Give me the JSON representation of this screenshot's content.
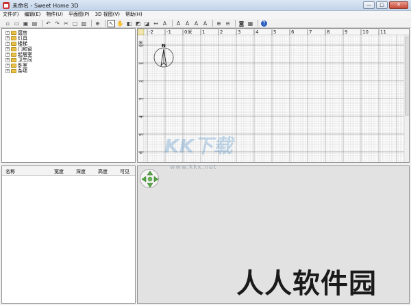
{
  "window": {
    "title": "未命名 - Sweet Home 3D",
    "minimize": "—",
    "maximize": "□",
    "close": "✕"
  },
  "menu": [
    "文件(F)",
    "编辑(E)",
    "物件(U)",
    "平面图(P)",
    "3D 视图(V)",
    "帮助(H)"
  ],
  "toolbar": {
    "help": "?"
  },
  "catalog": {
    "items": [
      "厨房",
      "灯具",
      "楼梯",
      "门和窗",
      "起居室",
      "卫生间",
      "卧室",
      "杂项"
    ]
  },
  "furniture_table": {
    "columns": [
      "名称",
      "宽度",
      "深度",
      "高度",
      "可见"
    ]
  },
  "plan": {
    "ruler_x": [
      "-2",
      "-1",
      "0米",
      "1",
      "2",
      "3",
      "4",
      "5",
      "6",
      "7",
      "8",
      "9",
      "10",
      "11"
    ],
    "ruler_y": [
      "0米",
      "1",
      "2",
      "3",
      "4",
      "5",
      "6"
    ],
    "compass_label": "N"
  },
  "watermarks": {
    "kk": "KK下载",
    "url": "www.kkx.net",
    "site": "人人软件园"
  }
}
